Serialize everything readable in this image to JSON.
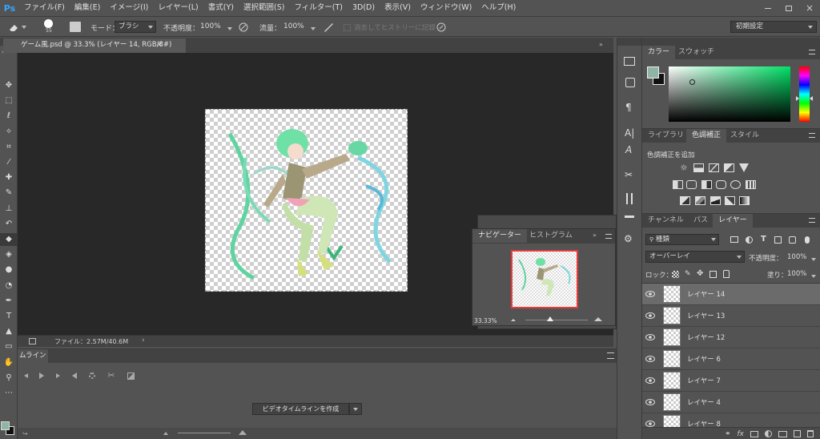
{
  "app": {
    "logo": "Ps",
    "menus": [
      "ファイル(F)",
      "編集(E)",
      "イメージ(I)",
      "レイヤー(L)",
      "書式(Y)",
      "選択範囲(S)",
      "フィルター(T)",
      "3D(D)",
      "表示(V)",
      "ウィンドウ(W)",
      "ヘルプ(H)"
    ]
  },
  "options": {
    "brush_size": "55",
    "mode_label": "モード：",
    "mode_value": "ブラシ",
    "opacity_label": "不透明度：",
    "opacity_value": "100%",
    "flow_label": "流量：",
    "flow_value": "100%",
    "history_label": "消去してヒストリーに記録",
    "workspace": "初期設定"
  },
  "document": {
    "tab_title": "ゲーム風.psd @ 33.3% (レイヤー 14, RGB/8#)",
    "close": "×",
    "file_info": "ファイル：2.57M/40.6M",
    "zoom": "33.33%"
  },
  "timeline": {
    "tab": "ムライン",
    "create_button": "ビデオタイムラインを作成"
  },
  "navigator": {
    "tabs": [
      "ナビゲーター",
      "ヒストグラム"
    ],
    "zoom": "33.33%"
  },
  "color_panel": {
    "tabs": [
      "カラー",
      "スウォッチ"
    ],
    "foreground": "#8fb5a5",
    "background": "#ffffff"
  },
  "adjust_panel": {
    "tabs": [
      "ライブラリ",
      "色調補正",
      "スタイル"
    ],
    "title": "色調補正を追加"
  },
  "layers_panel": {
    "tabs": [
      "チャンネル",
      "パス",
      "レイヤー"
    ],
    "filter": "種類",
    "blend_mode": "オーバーレイ",
    "opacity_label": "不透明度：",
    "opacity_value": "100%",
    "lock_label": "ロック：",
    "fill_label": "塗り：",
    "fill_value": "100%",
    "layers": [
      {
        "name": "レイヤー 14",
        "selected": true
      },
      {
        "name": "レイヤー 13",
        "selected": false
      },
      {
        "name": "レイヤー 12",
        "selected": false
      },
      {
        "name": "レイヤー 6",
        "selected": false
      },
      {
        "name": "レイヤー 7",
        "selected": false
      },
      {
        "name": "レイヤー 4",
        "selected": false
      },
      {
        "name": "レイヤー 8",
        "selected": false
      }
    ]
  },
  "icons": {
    "tools": [
      "move-icon",
      "marquee-icon",
      "lasso-icon",
      "magic-wand-icon",
      "crop-icon",
      "eyedropper-icon",
      "healing-brush-icon",
      "brush-icon",
      "stamp-icon",
      "history-brush-icon",
      "eraser-icon",
      "paint-bucket-icon",
      "blur-icon",
      "dodge-icon",
      "pen-icon",
      "type-icon",
      "path-select-icon",
      "rectangle-icon",
      "hand-icon",
      "zoom-icon",
      "more-icon"
    ]
  }
}
